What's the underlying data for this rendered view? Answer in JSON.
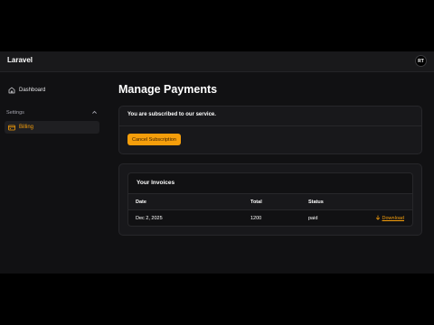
{
  "app": {
    "brand": "Laravel",
    "avatar_initials": "RT"
  },
  "sidebar": {
    "dashboard_label": "Dashboard",
    "group_label": "Settings",
    "billing_label": "Billing"
  },
  "main": {
    "title": "Manage Payments",
    "subscription_text": "You are subscribed to our service.",
    "cancel_button": "Cancel Subscription",
    "invoices_title": "Your Invoices",
    "columns": {
      "date": "Date",
      "total": "Total",
      "status": "Status"
    },
    "invoices": [
      {
        "date": "Dec 2, 2025",
        "total": "1200",
        "status": "paid",
        "action": "Download"
      }
    ]
  },
  "colors": {
    "accent": "#f59e0b",
    "background": "#111113",
    "card": "#18181b"
  }
}
